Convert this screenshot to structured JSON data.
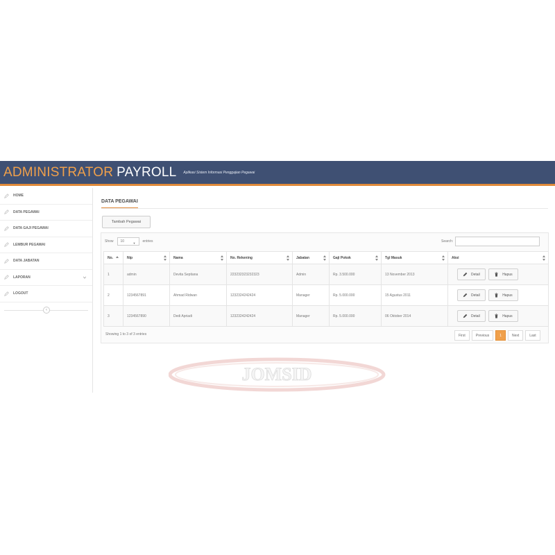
{
  "header": {
    "brand_part1": "ADMINISTRATOR",
    "brand_part2": "PAYROLL",
    "tagline": "Aplikasi Sistem Informasi Penggajian Pegawai"
  },
  "sidebar": {
    "items": [
      {
        "label": "HOME"
      },
      {
        "label": "DATA PEGAWAI"
      },
      {
        "label": "DATA GAJI PEGAWAI"
      },
      {
        "label": "LEMBUR PEGAWAI"
      },
      {
        "label": "DATA JABATAN"
      },
      {
        "label": "LAPORAN"
      },
      {
        "label": "LOGOUT"
      }
    ]
  },
  "main": {
    "title": "DATA PEGAWAI",
    "add_button": "Tambah Pegawai",
    "show_label": "Show",
    "show_value": "10",
    "entries_label": "entries",
    "search_label": "Search:",
    "search_value": "",
    "columns": [
      "No.",
      "Nip",
      "Nama",
      "No. Rekening",
      "Jabatan",
      "Gaji Pokok",
      "Tgl Masuk",
      "Aksi"
    ],
    "rows": [
      {
        "no": "1",
        "nip": "admin",
        "nama": "Devita Septiana",
        "rekening": "223232323232323",
        "jabatan": "Admin",
        "gaji": "Rp. 3.500.000",
        "tgl": "13 November 2013"
      },
      {
        "no": "2",
        "nip": "1234567891",
        "nama": "Ahmad Ridwan",
        "rekening": "1232324242424",
        "jabatan": "Manager",
        "gaji": "Rp. 5.000.000",
        "tgl": "15 Agustus 2011"
      },
      {
        "no": "3",
        "nip": "1234567890",
        "nama": "Dedi Apriadi",
        "rekening": "1232324242424",
        "jabatan": "Manager",
        "gaji": "Rp. 5.000.000",
        "tgl": "06 Oktober 2014"
      }
    ],
    "detail_label": "Detail",
    "hapus_label": "Hapus",
    "info": "Showing 1 to 3 of 3 entries",
    "pagination": {
      "first": "First",
      "previous": "Previous",
      "current": "1",
      "next": "Next",
      "last": "Last"
    }
  },
  "watermark": "JOMSID",
  "colors": {
    "header_bg": "#3f5073",
    "accent": "#f0a04b",
    "watermark_red": "#c0392b"
  }
}
